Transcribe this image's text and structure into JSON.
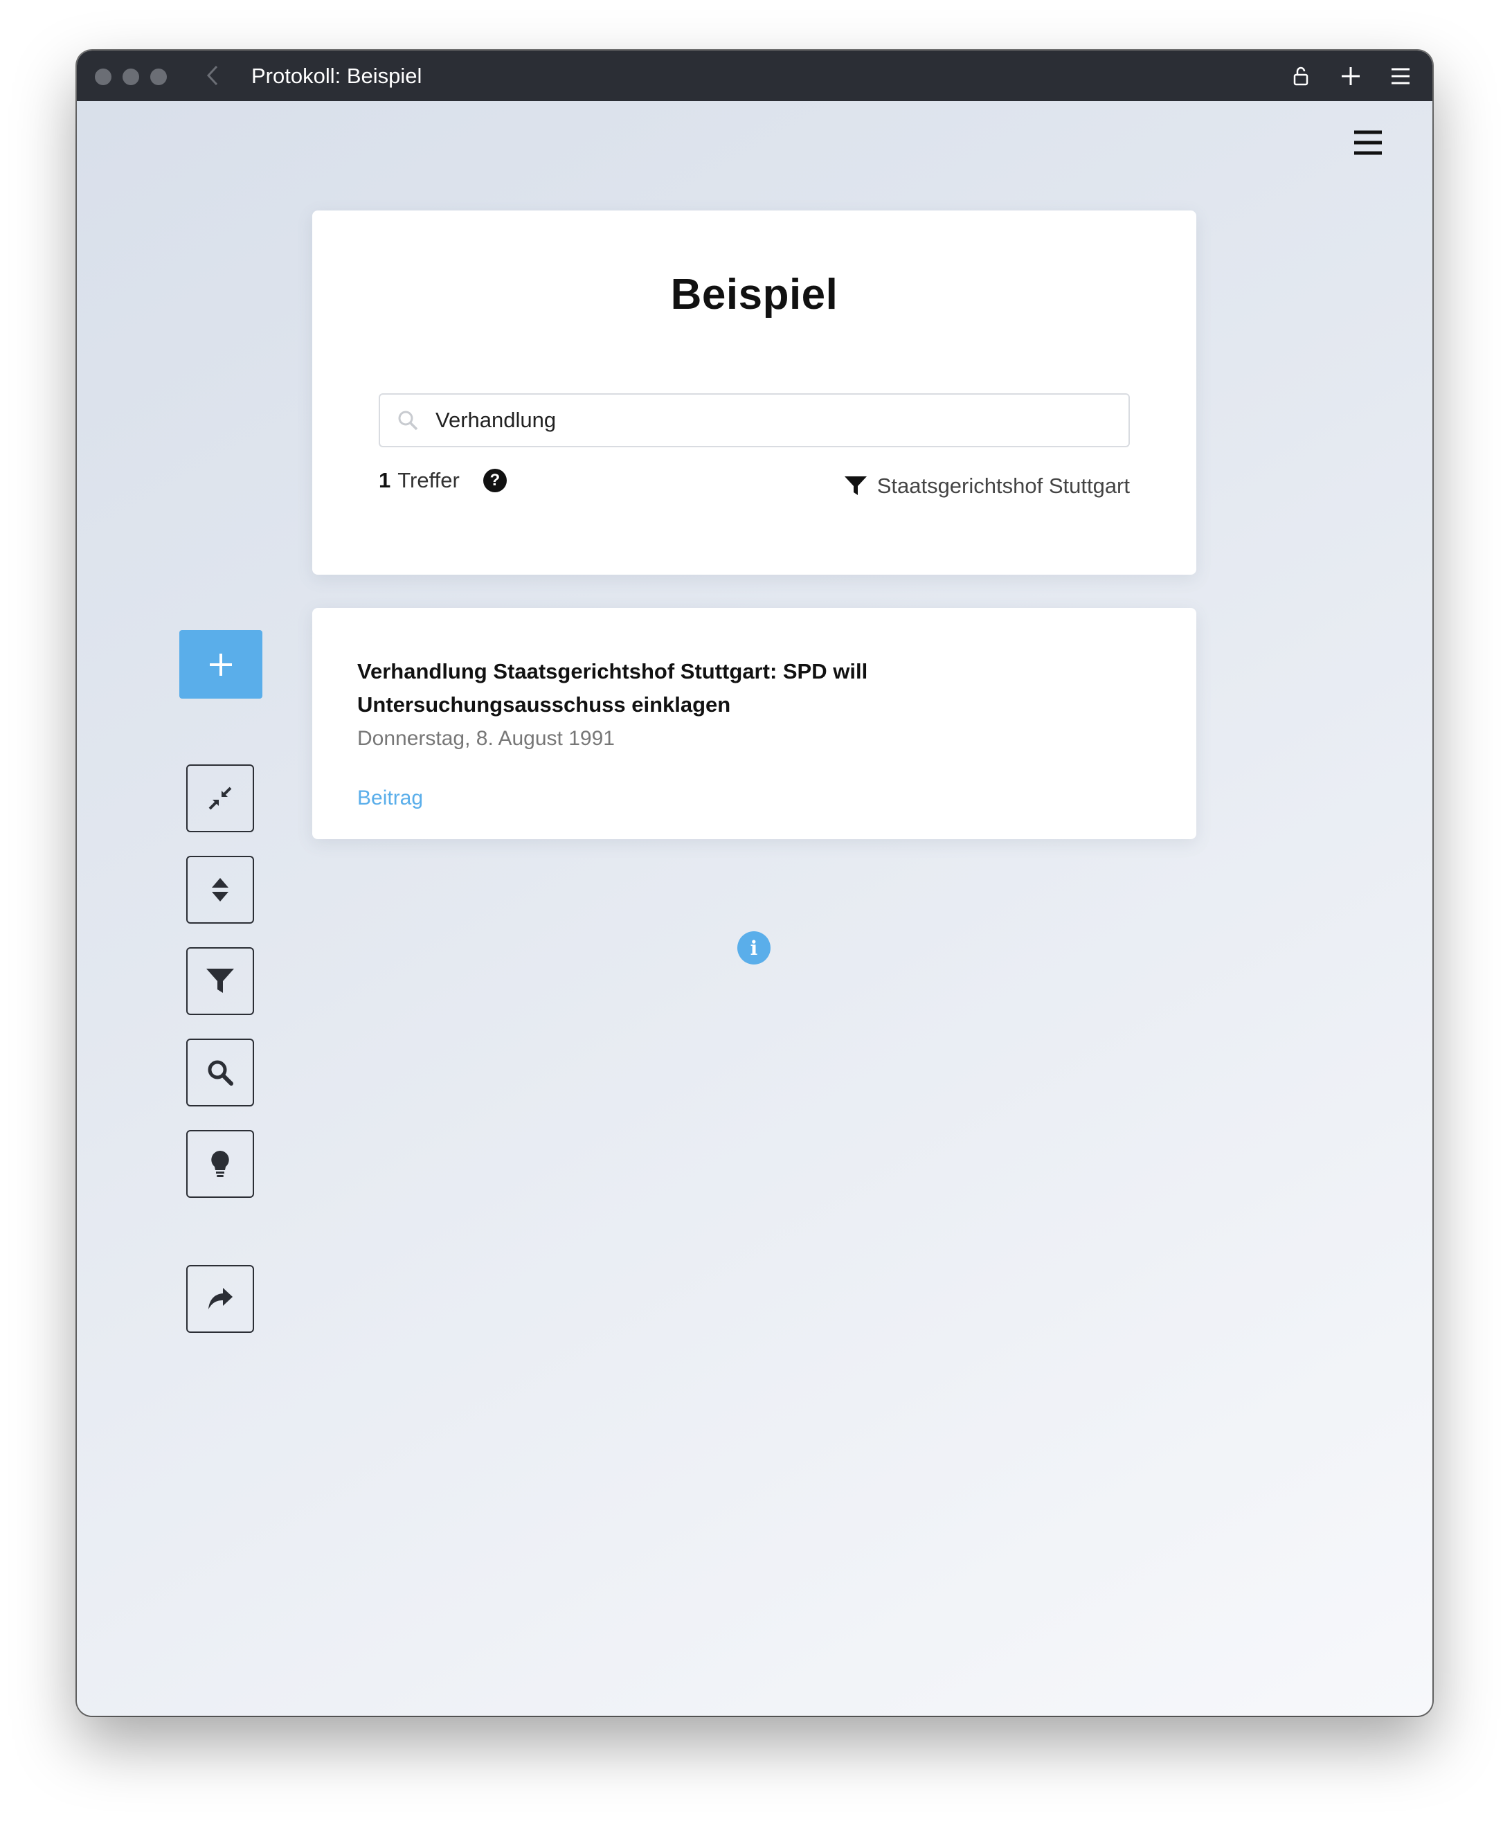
{
  "window": {
    "title": "Protokoll: Beispiel"
  },
  "page": {
    "title": "Beispiel"
  },
  "search": {
    "value": "Verhandlung",
    "placeholder": ""
  },
  "results": {
    "count": "1",
    "count_label": "Treffer",
    "filter_label": "Staatsgerichtshof Stuttgart"
  },
  "items": [
    {
      "title": "Verhandlung Staatsgerichtshof Stuttgart: SPD will Untersuchungsausschuss einklagen",
      "date": "Donnerstag, 8. August 1991",
      "type": "Beitrag"
    }
  ],
  "colors": {
    "accent": "#5aaeea",
    "titlebar": "#2b2e35"
  },
  "icons": {
    "toolbar": [
      "compress-icon",
      "sort-icon",
      "filter-icon",
      "search-icon",
      "lightbulb-icon",
      "share-icon"
    ]
  }
}
